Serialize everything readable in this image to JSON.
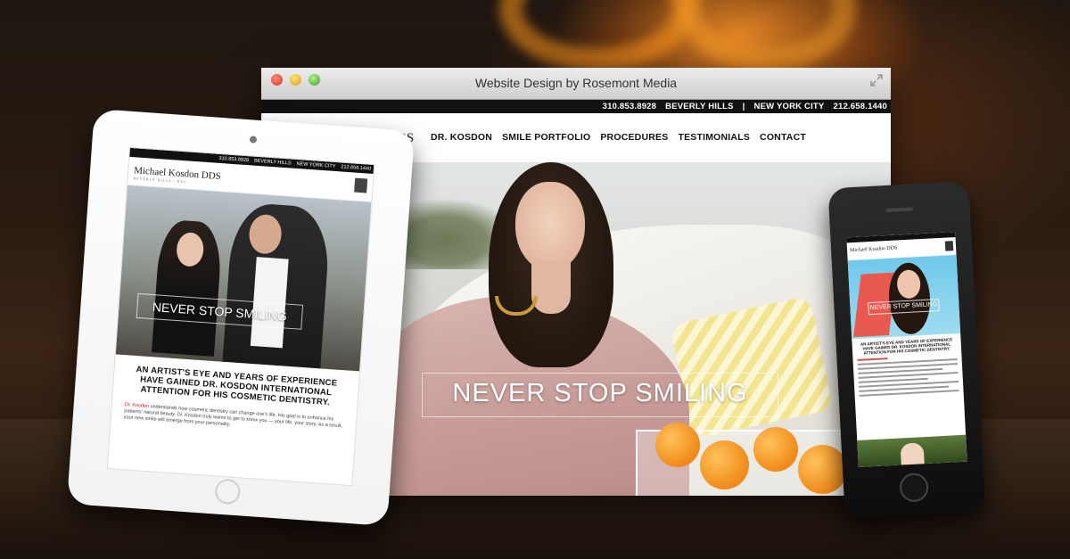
{
  "browser": {
    "window_title": "Website Design by Rosemont Media",
    "topbar": {
      "phone_bh": "310.853.8928",
      "city_bh": "BEVERLY HILLS",
      "separator": "|",
      "city_ny": "NEW YORK CITY",
      "phone_ny": "212.658.1440"
    },
    "nav": {
      "logo_fragment": "DS",
      "items": [
        "DR. KOSDON",
        "SMILE PORTFOLIO",
        "PROCEDURES",
        "TESTIMONIALS",
        "CONTACT"
      ]
    },
    "hero_title": "NEVER STOP SMILING"
  },
  "tablet": {
    "topbar": [
      "310.853.8928",
      "BEVERLY HILLS",
      "NEW YORK CITY",
      "212.658.1440"
    ],
    "logo": "Michael Kosdon DDS",
    "logo_sub": "BEVERLY HILLS | NYC",
    "hero_title": "NEVER STOP SMILING",
    "heading": "AN ARTIST'S EYE AND YEARS OF EXPERIENCE HAVE GAINED DR. KOSDON INTERNATIONAL ATTENTION FOR HIS COSMETIC DENTISTRY.",
    "paragraph_link": "Dr. Kosdon",
    "paragraph_text": "understands how cosmetic dentistry can change one's life. His goal is to enhance his patients' natural beauty. Dr. Kosdon truly wants to get to know you — your life, your story. As a result, your new smile will emerge from your personality."
  },
  "phone": {
    "logo": "Michael Kosdon DDS",
    "hero_title": "NEVER STOP SMILING",
    "heading": "AN ARTIST'S EYE AND YEARS OF EXPERIENCE HAVE GAINED DR. KOSDON INTERNATIONAL ATTENTION FOR HIS COSMETIC DENTISTRY."
  },
  "colors": {
    "accent_link": "#b22222",
    "topbar_bg": "#111111"
  }
}
